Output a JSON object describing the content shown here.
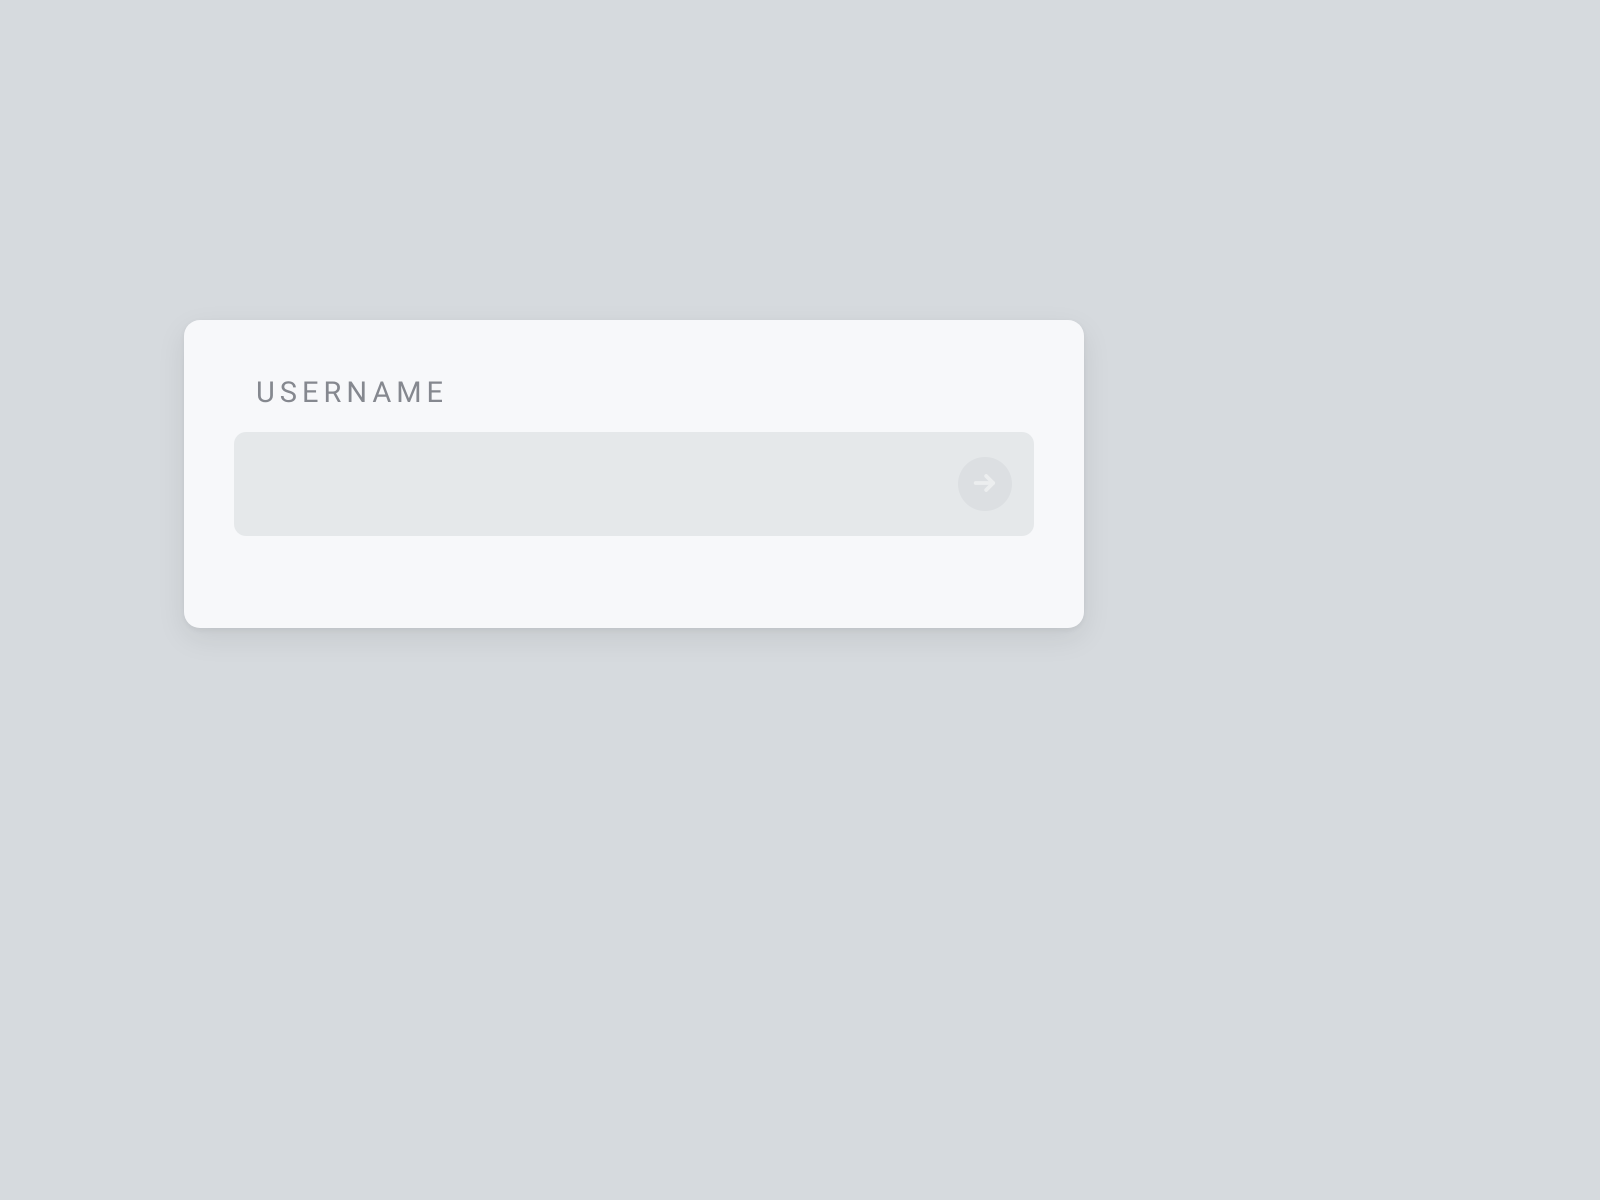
{
  "form": {
    "username_label": "USERNAME",
    "username_value": "",
    "username_placeholder": ""
  },
  "colors": {
    "page_bg": "#d6dade",
    "card_bg": "#f7f8fa",
    "input_bg": "#e5e8ea",
    "label_text": "#85888f",
    "button_bg": "#dcdfe2",
    "arrow_stroke": "#eceeef"
  },
  "icons": {
    "submit": "arrow-right-icon"
  }
}
